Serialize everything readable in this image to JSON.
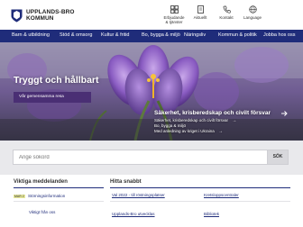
{
  "header": {
    "brand_line1": "UPPLANDS-BRO",
    "brand_line2": "KOMMUN",
    "utilities": [
      {
        "label": "Erbjudande & tjänster",
        "icon": "grid-icon"
      },
      {
        "label": "Aktuellt",
        "icon": "document-icon"
      },
      {
        "label": "Kontakt",
        "icon": "phone-icon"
      },
      {
        "label": "Language",
        "icon": "globe-icon"
      }
    ]
  },
  "nav": {
    "items": [
      "Barn & utbildning",
      "Stöd & omsorg",
      "Kultur & fritid",
      "Bo, bygga & miljö",
      "Näringsliv",
      "Kommun & politik",
      "Jobba hos oss"
    ]
  },
  "hero": {
    "title": "Tryggt och hållbart",
    "button_label": "Vår gemensamma resa",
    "card_title": "Säkerhet, krisberedskap och civilt försvar",
    "card_lines": [
      "Säkerhet, krisberedskap och civilt försvar",
      "Bo, bygga & miljö",
      "Med anledning av kriget i Ukraina"
    ]
  },
  "search": {
    "placeholder": "Ange sökord",
    "button_label": "SÖK"
  },
  "important": {
    "title": "Viktiga meddelanden",
    "items": [
      {
        "tag": "MAR 2",
        "text": "Störningsinformation"
      },
      {
        "tag": "",
        "text": "Viktigt från oss"
      }
    ]
  },
  "quick": {
    "title": "Hitta snabbt",
    "links": [
      "Val 2022 - till röstningsplatser",
      "Kretsloppscentraler",
      "Upplands-Bro utvecklas",
      "Bibliotek"
    ]
  },
  "colors": {
    "nav": "#1f2c7a",
    "hero_button": "#4a2f74",
    "search_band": "#e9e9ec"
  }
}
